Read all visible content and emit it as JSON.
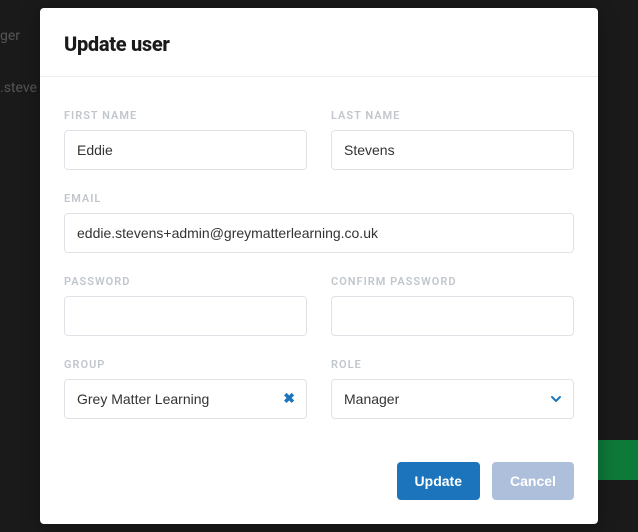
{
  "background": {
    "text1": "ger",
    "text2": ".steve"
  },
  "modal": {
    "title": "Update user",
    "fields": {
      "first_name": {
        "label": "FIRST NAME",
        "value": "Eddie"
      },
      "last_name": {
        "label": "LAST NAME",
        "value": "Stevens"
      },
      "email": {
        "label": "EMAIL",
        "value": "eddie.stevens+admin@greymatterlearning.co.uk"
      },
      "password": {
        "label": "PASSWORD",
        "value": ""
      },
      "confirm_password": {
        "label": "CONFIRM PASSWORD",
        "value": ""
      },
      "group": {
        "label": "GROUP",
        "value": "Grey Matter Learning"
      },
      "role": {
        "label": "ROLE",
        "value": "Manager"
      }
    },
    "buttons": {
      "update": "Update",
      "cancel": "Cancel"
    }
  }
}
